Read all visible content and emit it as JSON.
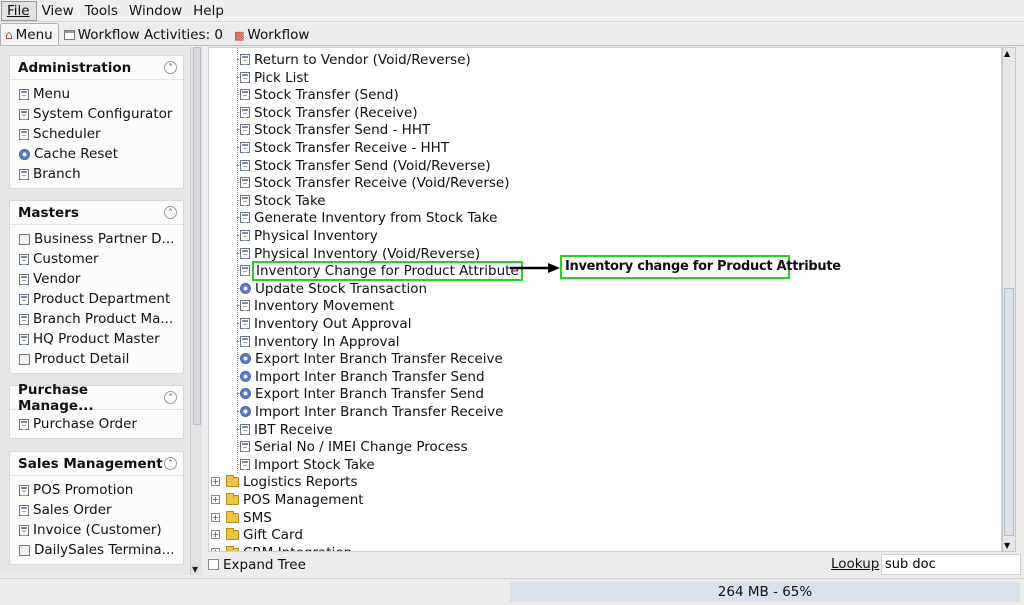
{
  "menubar": {
    "file": "File",
    "view": "View",
    "tools": "Tools",
    "window": "Window",
    "help": "Help"
  },
  "tabs": {
    "menu": "Menu",
    "workflow_activities": "Workflow Activities: 0",
    "workflow": "Workflow"
  },
  "sidebar": {
    "administration": {
      "title": "Administration",
      "items": [
        {
          "label": "Menu",
          "icon": "document-icon"
        },
        {
          "label": "System Configurator",
          "icon": "document-icon"
        },
        {
          "label": "Scheduler",
          "icon": "document-icon"
        },
        {
          "label": "Cache Reset",
          "icon": "gear-icon"
        },
        {
          "label": "Branch",
          "icon": "document-icon"
        }
      ]
    },
    "masters": {
      "title": "Masters",
      "items": [
        {
          "label": "Business Partner D...",
          "icon": "box-icon"
        },
        {
          "label": "Customer",
          "icon": "document-icon"
        },
        {
          "label": "Vendor",
          "icon": "document-icon"
        },
        {
          "label": "Product Department",
          "icon": "document-icon"
        },
        {
          "label": "Branch Product Ma...",
          "icon": "document-icon"
        },
        {
          "label": "HQ Product Master",
          "icon": "document-icon"
        },
        {
          "label": "Product Detail",
          "icon": "box-icon"
        }
      ]
    },
    "purchase": {
      "title": "Purchase Manage...",
      "items": [
        {
          "label": "Purchase Order",
          "icon": "document-icon"
        }
      ]
    },
    "sales": {
      "title": "Sales Management",
      "items": [
        {
          "label": "POS Promotion",
          "icon": "document-icon"
        },
        {
          "label": "Sales Order",
          "icon": "document-icon"
        },
        {
          "label": "Invoice (Customer)",
          "icon": "document-icon"
        },
        {
          "label": "DailySales Termina...",
          "icon": "box-icon"
        }
      ]
    }
  },
  "tree": {
    "items": [
      {
        "label": "Return to Vendor (Void/Reverse)",
        "icon": "document-icon"
      },
      {
        "label": "Pick List",
        "icon": "document-icon"
      },
      {
        "label": "Stock Transfer (Send)",
        "icon": "document-icon"
      },
      {
        "label": "Stock Transfer (Receive)",
        "icon": "document-icon"
      },
      {
        "label": "Stock Transfer Send - HHT",
        "icon": "document-icon"
      },
      {
        "label": "Stock Transfer Receive - HHT",
        "icon": "document-icon"
      },
      {
        "label": "Stock Transfer Send (Void/Reverse)",
        "icon": "document-icon"
      },
      {
        "label": "Stock Transfer Receive (Void/Reverse)",
        "icon": "document-icon"
      },
      {
        "label": "Stock Take",
        "icon": "document-icon"
      },
      {
        "label": "Generate Inventory from Stock Take",
        "icon": "document-icon"
      },
      {
        "label": "Physical Inventory",
        "icon": "document-icon"
      },
      {
        "label": "Physical Inventory (Void/Reverse)",
        "icon": "document-icon"
      },
      {
        "label": "Inventory Change for Product Attribute",
        "icon": "document-icon"
      },
      {
        "label": "Update Stock Transaction",
        "icon": "gear-icon"
      },
      {
        "label": "Inventory Movement",
        "icon": "document-icon"
      },
      {
        "label": "Inventory Out Approval",
        "icon": "document-icon"
      },
      {
        "label": "Inventory In Approval",
        "icon": "document-icon"
      },
      {
        "label": "Export Inter Branch Transfer Receive",
        "icon": "gear-icon"
      },
      {
        "label": "Import Inter Branch Transfer Send",
        "icon": "gear-icon"
      },
      {
        "label": "Export Inter Branch Transfer Send",
        "icon": "gear-icon"
      },
      {
        "label": "Import Inter Branch Transfer Receive",
        "icon": "gear-icon"
      },
      {
        "label": "IBT Receive",
        "icon": "document-icon"
      },
      {
        "label": "Serial No / IMEI Change Process",
        "icon": "document-icon"
      },
      {
        "label": "Import Stock Take",
        "icon": "document-icon"
      }
    ],
    "folders": [
      {
        "label": "Logistics Reports"
      },
      {
        "label": "POS Management"
      },
      {
        "label": "SMS"
      },
      {
        "label": "Gift Card"
      },
      {
        "label": "CRM Integration"
      }
    ],
    "highlighted_index": 12
  },
  "annotation": {
    "text": "Inventory change for Product Attribute",
    "color": "#22d322"
  },
  "bottom": {
    "expand_tree": "Expand Tree",
    "lookup_label": "Lookup",
    "lookup_value": "sub doc"
  },
  "status": {
    "memory": "264 MB - 65%"
  }
}
